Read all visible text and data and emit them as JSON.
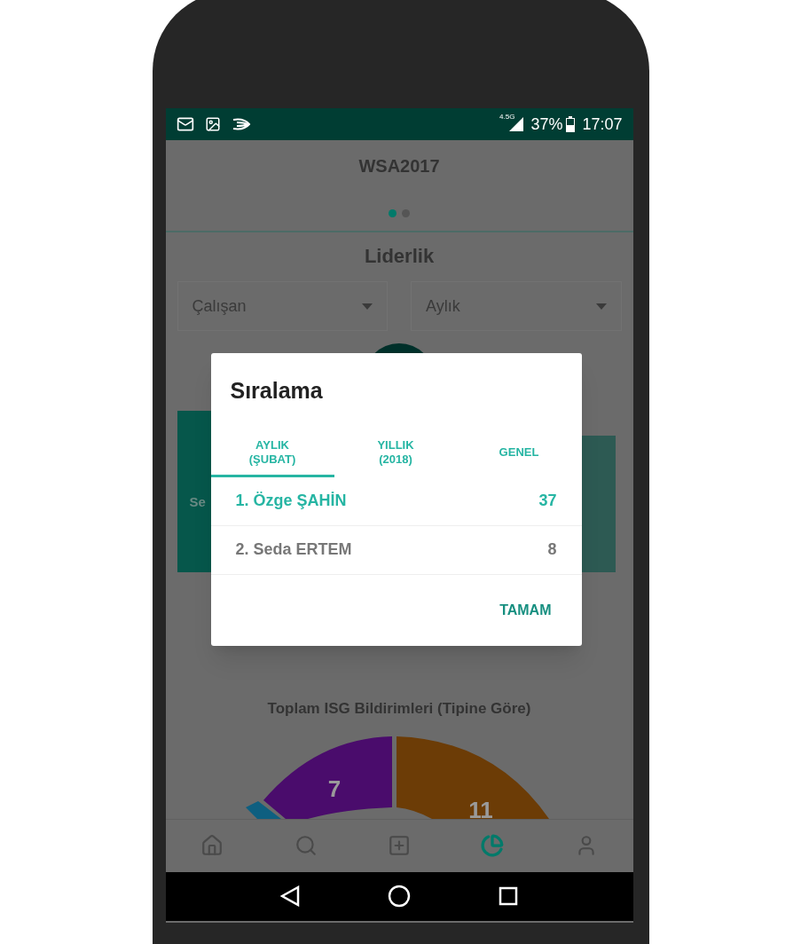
{
  "status_bar": {
    "network": "4.5G",
    "battery": "37%",
    "time": "17:07"
  },
  "app": {
    "title": "WSA2017",
    "pages": [
      {
        "selected": true
      },
      {
        "selected": false
      }
    ]
  },
  "leadership": {
    "title": "Liderlik",
    "filters": [
      {
        "value": "Çalışan"
      },
      {
        "value": "Aylık"
      }
    ],
    "card_text": "Se"
  },
  "dialog": {
    "title": "Sıralama",
    "tabs": [
      {
        "label": "AYLIK\n(ŞUBAT)",
        "selected": true
      },
      {
        "label": "YILLIK\n(2018)",
        "selected": false
      },
      {
        "label": "GENEL",
        "selected": false
      }
    ],
    "rows": [
      {
        "name": "1. Özge ŞAHİN",
        "score": "37",
        "highlighted": true
      },
      {
        "name": "2. Seda ERTEM",
        "score": "8",
        "highlighted": false
      }
    ],
    "button": "TAMAM"
  },
  "chart": {
    "title": "Toplam ISG Bildirimleri (Tipine Göre)",
    "slices": [
      {
        "color": "#0e5f80"
      },
      {
        "label": "7",
        "color": "#4a0c6c"
      },
      {
        "label": "11",
        "color": "#6c3c06"
      }
    ]
  },
  "bottom_nav": [
    {
      "kind": "home",
      "selected": false
    },
    {
      "kind": "search",
      "selected": false
    },
    {
      "kind": "add",
      "selected": false
    },
    {
      "kind": "chart",
      "selected": true
    },
    {
      "kind": "profile",
      "selected": false
    }
  ]
}
